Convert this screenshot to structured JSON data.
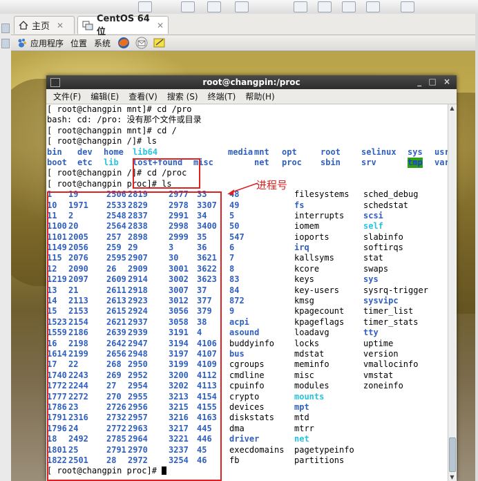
{
  "tabs": [
    {
      "label": "主页",
      "active": false
    },
    {
      "label": "CentOS 64 位",
      "active": true
    }
  ],
  "panel": {
    "applications": "应用程序",
    "places": "位置",
    "system": "系统"
  },
  "window": {
    "title": "root@changpin:/proc",
    "controls": "_ □ ×"
  },
  "menu": [
    "文件(F)",
    "编辑(E)",
    "查看(V)",
    "搜索 (S)",
    "终端(T)",
    "帮助(H)"
  ],
  "colors": {
    "dir": "#2f5fbf",
    "link_or_exec": "#27c3e0",
    "highlight_bg": "#2da014",
    "annotation": "#e02020"
  },
  "annotation": {
    "label": "进程号"
  },
  "prompt_lines": [
    "[ root@changpin mnt]# cd /pro",
    "bash: cd: /pro: 没有那个文件或目录",
    "[ root@changpin mnt]# cd /",
    "[ root@changpin /]# ls"
  ],
  "root_ls": [
    [
      "bin",
      "dev",
      "home",
      "lib64",
      "",
      "media",
      "mnt",
      "opt",
      "root",
      "selinux",
      "sys",
      "usr"
    ],
    [
      "boot",
      "etc",
      "lib",
      "lost+found",
      "misc",
      "",
      "net",
      "proc",
      "sbin",
      "srv",
      "tmp",
      "var"
    ]
  ],
  "prompt_lines2": [
    "[ root@changpin /]# cd /proc",
    "[ root@changpin proc]# ls"
  ],
  "proc_rows": [
    [
      "1",
      "19",
      "2506",
      "2819",
      "2977",
      "33",
      "48",
      "filesystems",
      "sched_debug"
    ],
    [
      "10",
      "1971",
      "2533",
      "2829",
      "2978",
      "3307",
      "49",
      "fs",
      "schedstat"
    ],
    [
      "11",
      "2",
      "2548",
      "2837",
      "2991",
      "34",
      "5",
      "interrupts",
      "scsi"
    ],
    [
      "1100",
      "20",
      "2564",
      "2838",
      "2998",
      "3400",
      "50",
      "iomem",
      "self"
    ],
    [
      "1101",
      "2005",
      "257",
      "2898",
      "2999",
      "35",
      "547",
      "ioports",
      "slabinfo"
    ],
    [
      "1149",
      "2056",
      "259",
      "29",
      "3",
      "36",
      "6",
      "irq",
      "softirqs"
    ],
    [
      "115",
      "2076",
      "2595",
      "2907",
      "30",
      "3621",
      "7",
      "kallsyms",
      "stat"
    ],
    [
      "12",
      "2090",
      "26",
      "2909",
      "3001",
      "3622",
      "8",
      "kcore",
      "swaps"
    ],
    [
      "1219",
      "2097",
      "2609",
      "2914",
      "3002",
      "3623",
      "83",
      "keys",
      "sys"
    ],
    [
      "13",
      "21",
      "2611",
      "2918",
      "3007",
      "37",
      "84",
      "key-users",
      "sysrq-trigger"
    ],
    [
      "14",
      "2113",
      "2613",
      "2923",
      "3012",
      "377",
      "872",
      "kmsg",
      "sysvipc"
    ],
    [
      "15",
      "2153",
      "2615",
      "2924",
      "3056",
      "379",
      "9",
      "kpagecount",
      "timer_list"
    ],
    [
      "1523",
      "2154",
      "2621",
      "2937",
      "3058",
      "38",
      "acpi",
      "kpageflags",
      "timer_stats"
    ],
    [
      "1559",
      "2186",
      "2639",
      "2939",
      "3191",
      "4",
      "asound",
      "loadavg",
      "tty"
    ],
    [
      "16",
      "2198",
      "2642",
      "2947",
      "3194",
      "4106",
      "buddyinfo",
      "locks",
      "uptime"
    ],
    [
      "1614",
      "2199",
      "2656",
      "2948",
      "3197",
      "4107",
      "bus",
      "mdstat",
      "version"
    ],
    [
      "17",
      "22",
      "268",
      "2950",
      "3199",
      "4109",
      "cgroups",
      "meminfo",
      "vmallocinfo"
    ],
    [
      "1740",
      "2243",
      "269",
      "2952",
      "3200",
      "4112",
      "cmdline",
      "misc",
      "vmstat"
    ],
    [
      "1772",
      "2244",
      "27",
      "2954",
      "3202",
      "4113",
      "cpuinfo",
      "modules",
      "zoneinfo"
    ],
    [
      "1777",
      "2272",
      "270",
      "2955",
      "3213",
      "4154",
      "crypto",
      "mounts",
      ""
    ],
    [
      "1786",
      "23",
      "2726",
      "2956",
      "3215",
      "4155",
      "devices",
      "mpt",
      ""
    ],
    [
      "1791",
      "2316",
      "2732",
      "2957",
      "3216",
      "4163",
      "diskstats",
      "mtd",
      ""
    ],
    [
      "1796",
      "24",
      "2772",
      "2963",
      "3217",
      "445",
      "dma",
      "mtrr",
      ""
    ],
    [
      "18",
      "2492",
      "2785",
      "2964",
      "3221",
      "446",
      "driver",
      "net",
      ""
    ],
    [
      "1801",
      "25",
      "2791",
      "2970",
      "3237",
      "45",
      "execdomains",
      "pagetypeinfo",
      ""
    ],
    [
      "1822",
      "2501",
      "28",
      "2972",
      "3254",
      "46",
      "fb",
      "partitions",
      ""
    ]
  ],
  "final_prompt": "[ root@changpin proc]# "
}
